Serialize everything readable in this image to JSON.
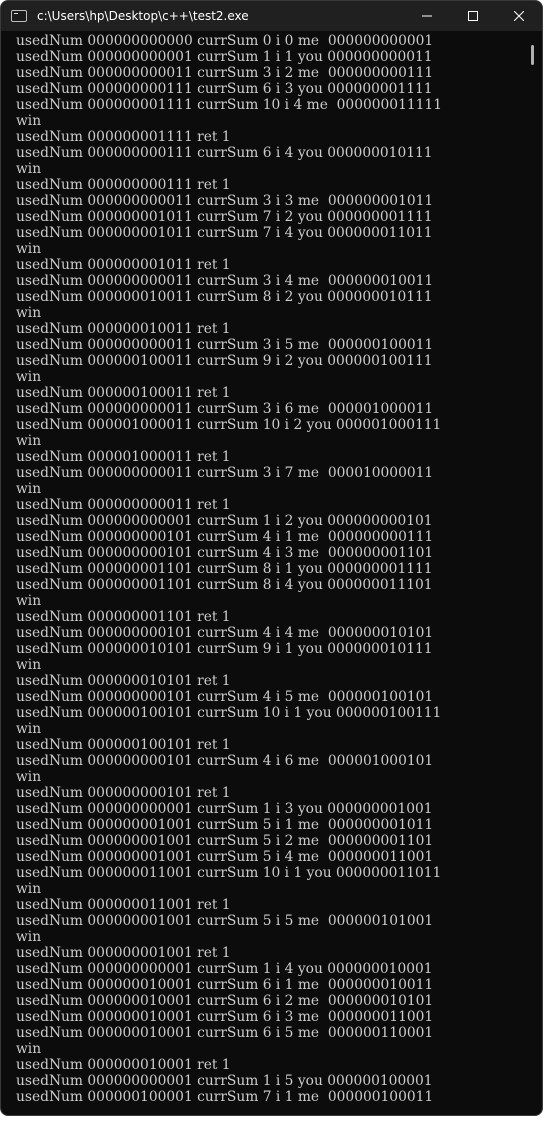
{
  "window": {
    "title": "c:\\Users\\hp\\Desktop\\c++\\test2.exe",
    "icons": {
      "app": "console-app-icon",
      "minimize": "minimize-icon",
      "maximize": "maximize-icon",
      "close": "close-icon"
    }
  },
  "console": {
    "lines": [
      "usedNum 000000000000 currSum 0 i 0 me  000000000001",
      "usedNum 000000000001 currSum 1 i 1 you 000000000011",
      "usedNum 000000000011 currSum 3 i 2 me  000000000111",
      "usedNum 000000000111 currSum 6 i 3 you 000000001111",
      "usedNum 000000001111 currSum 10 i 4 me  000000011111",
      "win",
      "usedNum 000000001111 ret 1",
      "usedNum 000000000111 currSum 6 i 4 you 000000010111",
      "win",
      "usedNum 000000000111 ret 1",
      "usedNum 000000000011 currSum 3 i 3 me  000000001011",
      "usedNum 000000001011 currSum 7 i 2 you 000000001111",
      "usedNum 000000001011 currSum 7 i 4 you 000000011011",
      "win",
      "usedNum 000000001011 ret 1",
      "usedNum 000000000011 currSum 3 i 4 me  000000010011",
      "usedNum 000000010011 currSum 8 i 2 you 000000010111",
      "win",
      "usedNum 000000010011 ret 1",
      "usedNum 000000000011 currSum 3 i 5 me  000000100011",
      "usedNum 000000100011 currSum 9 i 2 you 000000100111",
      "win",
      "usedNum 000000100011 ret 1",
      "usedNum 000000000011 currSum 3 i 6 me  000001000011",
      "usedNum 000001000011 currSum 10 i 2 you 000001000111",
      "win",
      "usedNum 000001000011 ret 1",
      "usedNum 000000000011 currSum 3 i 7 me  000010000011",
      "win",
      "usedNum 000000000011 ret 1",
      "usedNum 000000000001 currSum 1 i 2 you 000000000101",
      "usedNum 000000000101 currSum 4 i 1 me  000000000111",
      "usedNum 000000000101 currSum 4 i 3 me  000000001101",
      "usedNum 000000001101 currSum 8 i 1 you 000000001111",
      "usedNum 000000001101 currSum 8 i 4 you 000000011101",
      "win",
      "usedNum 000000001101 ret 1",
      "usedNum 000000000101 currSum 4 i 4 me  000000010101",
      "usedNum 000000010101 currSum 9 i 1 you 000000010111",
      "win",
      "usedNum 000000010101 ret 1",
      "usedNum 000000000101 currSum 4 i 5 me  000000100101",
      "usedNum 000000100101 currSum 10 i 1 you 000000100111",
      "win",
      "usedNum 000000100101 ret 1",
      "usedNum 000000000101 currSum 4 i 6 me  000001000101",
      "win",
      "usedNum 000000000101 ret 1",
      "usedNum 000000000001 currSum 1 i 3 you 000000001001",
      "usedNum 000000001001 currSum 5 i 1 me  000000001011",
      "usedNum 000000001001 currSum 5 i 2 me  000000001101",
      "usedNum 000000001001 currSum 5 i 4 me  000000011001",
      "usedNum 000000011001 currSum 10 i 1 you 000000011011",
      "win",
      "usedNum 000000011001 ret 1",
      "usedNum 000000001001 currSum 5 i 5 me  000000101001",
      "win",
      "usedNum 000000001001 ret 1",
      "usedNum 000000000001 currSum 1 i 4 you 000000010001",
      "usedNum 000000010001 currSum 6 i 1 me  000000010011",
      "usedNum 000000010001 currSum 6 i 2 me  000000010101",
      "usedNum 000000010001 currSum 6 i 3 me  000000011001",
      "usedNum 000000010001 currSum 6 i 5 me  000000110001",
      "win",
      "usedNum 000000010001 ret 1",
      "usedNum 000000000001 currSum 1 i 5 you 000000100001",
      "usedNum 000000100001 currSum 7 i 1 me  000000100011"
    ]
  }
}
